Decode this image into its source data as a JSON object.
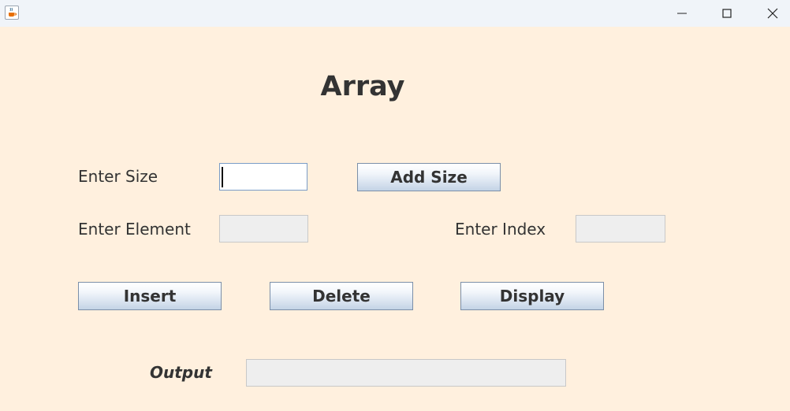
{
  "window": {
    "title": "",
    "icons": {
      "app": "java-cup-icon",
      "minimize": "minimize-icon",
      "maximize": "maximize-icon",
      "close": "close-icon"
    }
  },
  "form": {
    "title": "Array",
    "size_label": "Enter Size",
    "size_value": "",
    "add_size_label": "Add Size",
    "element_label": "Enter Element",
    "element_value": "",
    "index_label": "Enter Index",
    "index_value": "",
    "insert_label": "Insert",
    "delete_label": "Delete",
    "display_label": "Display",
    "output_label": "Output",
    "output_value": ""
  },
  "colors": {
    "background": "#fff0de",
    "titlebar": "#f0f4f9",
    "text": "#333333",
    "field_disabled": "#eeeeee",
    "button_border": "#7b8fa8"
  }
}
